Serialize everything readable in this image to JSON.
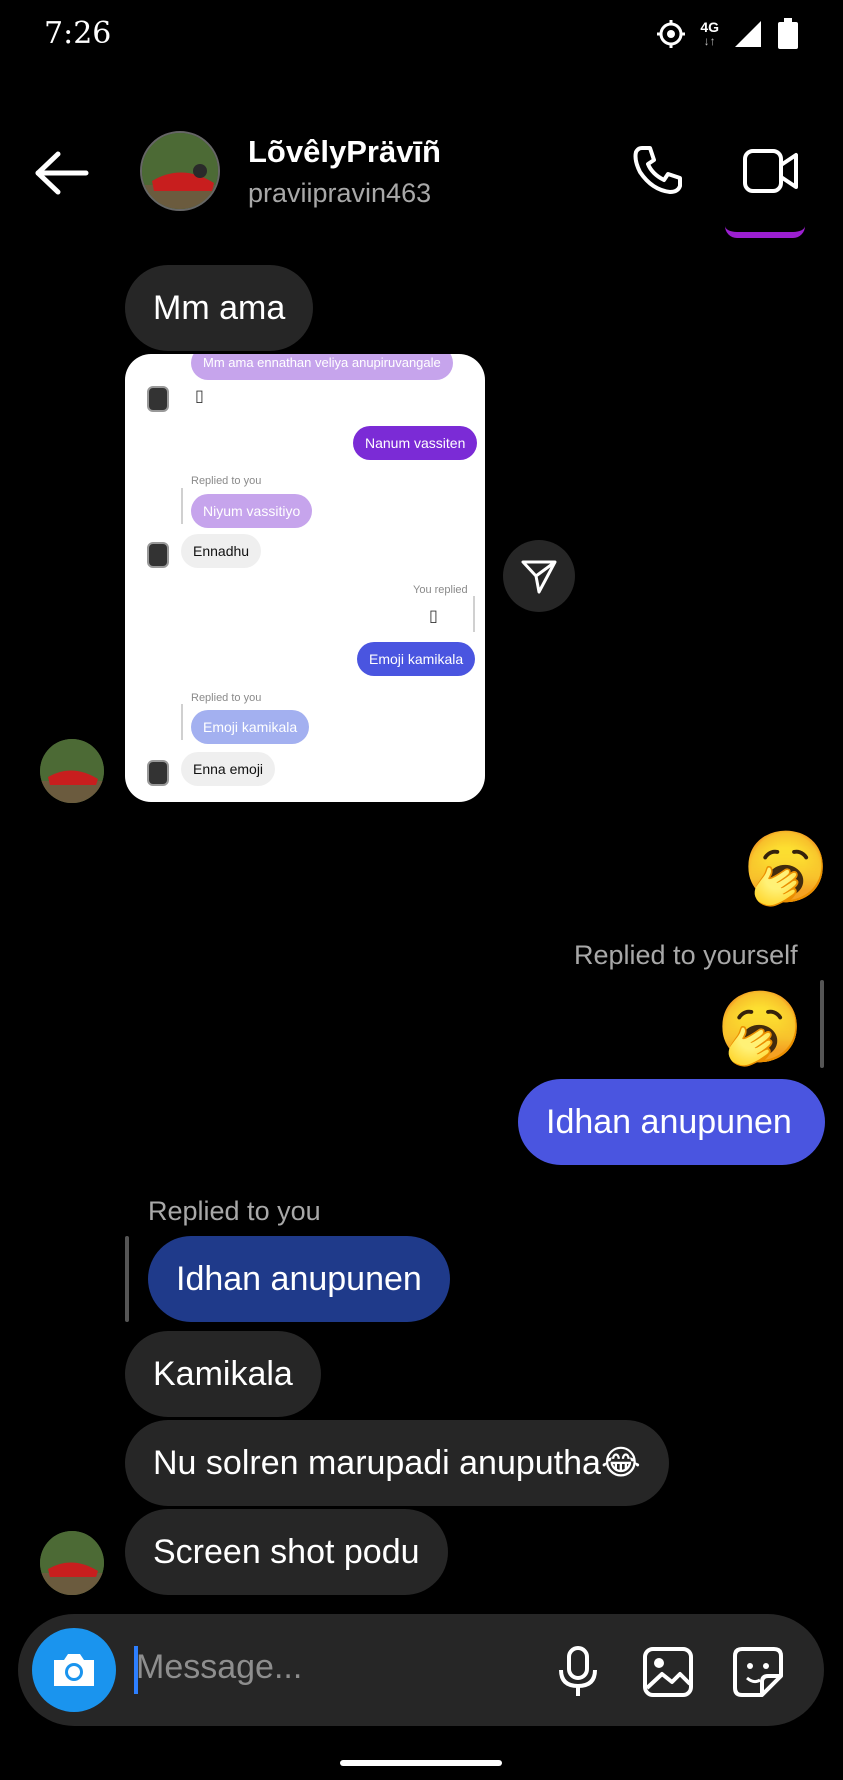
{
  "status_bar": {
    "time": "7:26",
    "network": "4G"
  },
  "header": {
    "name": "LõvêlyPrävīñ",
    "username": "praviipravin463",
    "back_icon": "arrow-left-icon",
    "call_icon": "phone-icon",
    "video_icon": "video-camera-icon"
  },
  "messages": {
    "m1": "Mm ama",
    "replied_to_yourself": "Replied to yourself",
    "out_bubble": "Idhan anupunen",
    "replied_to_you": "Replied to you",
    "quoted": "Idhan anupunen",
    "m2": "Kamikala",
    "m3": "Nu solren marupadi anuputha😂",
    "m4": "Screen shot podu",
    "emoji_1": "🥱",
    "emoji_2": "🥱"
  },
  "shared_screenshot": {
    "top_partial": "Mm ama ennathan veliya anupiruvangale",
    "out1": "Nanum vassiten",
    "cap1": "Replied to you",
    "quote1": "Niyum vassitiyo",
    "in1": "Ennadhu",
    "cap2": "You replied",
    "out2": "Emoji kamikala",
    "cap3": "Replied to you",
    "quote2": "Emoji kamikala",
    "in2": "Enna emoji",
    "box_glyph": "▯"
  },
  "composer": {
    "placeholder": "Message...",
    "icons": [
      "camera-icon",
      "microphone-icon",
      "gallery-icon",
      "sticker-icon"
    ]
  },
  "colors": {
    "accent": "#4a55e0",
    "camera": "#1a94ee",
    "bubble_in": "#262626"
  }
}
